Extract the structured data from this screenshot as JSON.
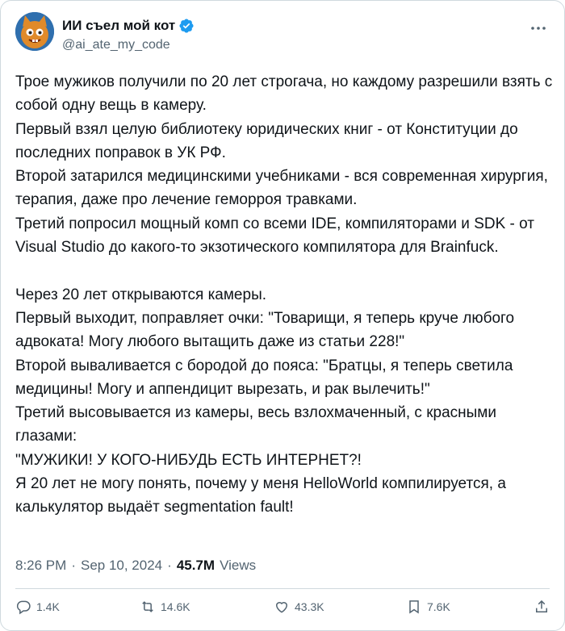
{
  "author": {
    "display_name": "ИИ съел мой кот",
    "handle": "@ai_ate_my_code",
    "verified_icon": "verified-badge-icon"
  },
  "tweet": {
    "lines": [
      "Трое мужиков получили по 20 лет строгача, но каждому разрешили взять с собой одну вещь в камеру.",
      "Первый взял целую библиотеку юридических книг - от Конституции до последних поправок в УК РФ.",
      "Второй затарился медицинскими учебниками - вся современная хирургия, терапия, даже про лечение геморроя травками.",
      "Третий попросил мощный комп со всеми IDE, компиляторами и SDK - от Visual Studio до какого-то экзотического компилятора для Brainfuck.",
      "",
      "Через 20 лет открываются камеры.",
      "Первый выходит, поправляет очки: \"Товарищи, я теперь круче любого адвоката! Могу любого вытащить даже из статьи 228!\"",
      "Второй вываливается с бородой до пояса: \"Братцы, я теперь светила медицины! Могу и аппендицит вырезать, и рак вылечить!\"",
      "Третий высовывается из камеры, весь взлохмаченный, с красными глазами:",
      "\"МУЖИКИ! У КОГО-НИБУДЬ ЕСТЬ ИНТЕРНЕТ?!",
      "Я 20 лет не могу понять, почему у меня HelloWorld компилируется, а калькулятор выдаёт segmentation fault!"
    ]
  },
  "meta": {
    "time": "8:26 PM",
    "sep1": "·",
    "date": "Sep 10, 2024",
    "sep2": "·",
    "views_count": "45.7M",
    "views_label": "Views"
  },
  "actions": {
    "replies": "1.4K",
    "reposts": "14.6K",
    "likes": "43.3K",
    "bookmarks": "7.6K"
  },
  "colors": {
    "text": "#0f1419",
    "secondary": "#536471",
    "verified": "#1d9bf0",
    "border": "#cfd9de"
  }
}
